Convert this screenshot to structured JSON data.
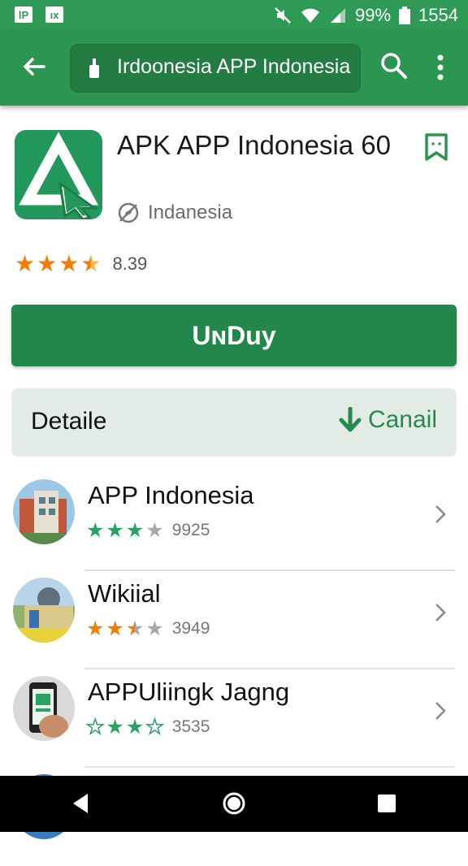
{
  "status_bar": {
    "battery": "99%",
    "time": "1554",
    "left_icon_1": "lP",
    "left_icon_2": "ıx"
  },
  "app_bar": {
    "search_text": "Irdoonesia APP Indonesia"
  },
  "app": {
    "title": "APK APP Indonesia 60",
    "developer": "Indanesia",
    "rating": "8.39",
    "rating_value": 3.5,
    "install_label": "UɴDuy"
  },
  "details": {
    "label": "Detaile",
    "download_label": "Canail"
  },
  "related": [
    {
      "title": "APP Indonesia",
      "count": "9925",
      "stars": 3,
      "star_color": "#2aa262"
    },
    {
      "title": "Wikiial",
      "count": "3949",
      "stars": 2.5,
      "star_color": "#f57c00"
    },
    {
      "title": "APPUliingk Jagng",
      "count": "3535",
      "stars": 3.5,
      "star_color": "#2aa262"
    }
  ],
  "colors": {
    "accent": "#2d9552",
    "accent_dark": "#23864a",
    "star_orange": "#f57c00",
    "star_green": "#2aa262"
  },
  "icons": [
    "back-arrow-icon",
    "lock-icon",
    "search-icon",
    "more-vert-icon",
    "bookmark-icon",
    "compass-icon",
    "download-icon",
    "chevron-right-icon"
  ]
}
